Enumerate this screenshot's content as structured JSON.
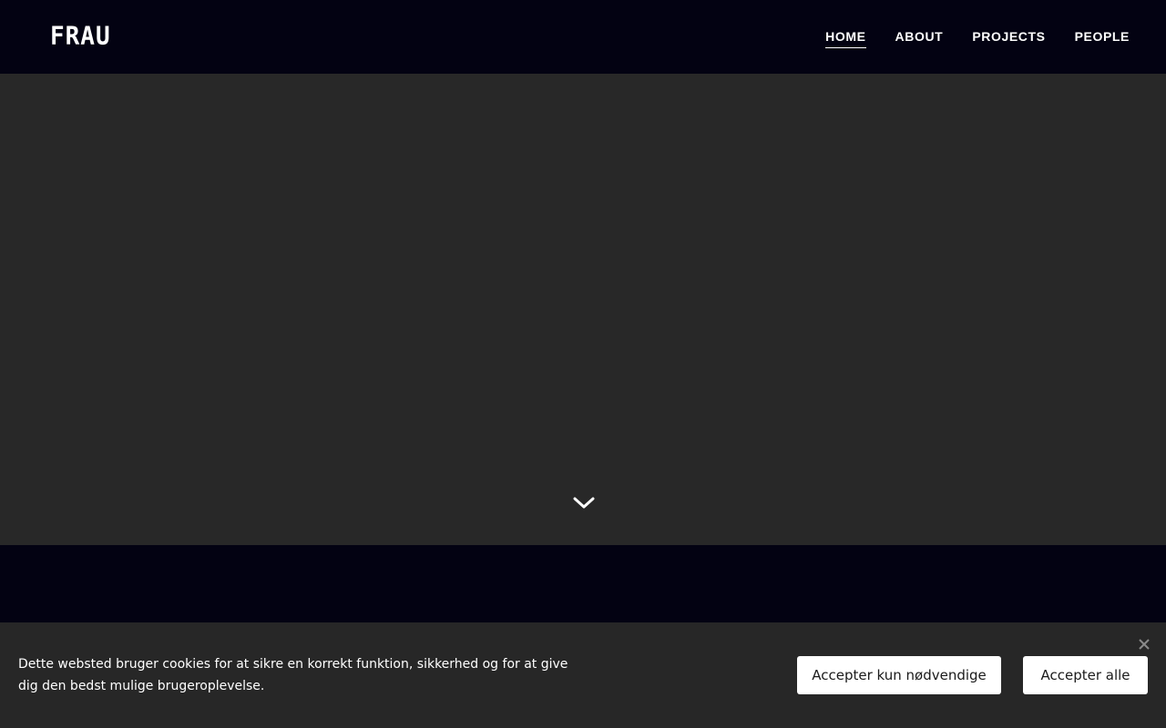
{
  "header": {
    "logo": "FRAU",
    "nav": [
      {
        "label": "HOME",
        "active": true
      },
      {
        "label": "ABOUT",
        "active": false
      },
      {
        "label": "PROJECTS",
        "active": false
      },
      {
        "label": "PEOPLE",
        "active": false
      }
    ]
  },
  "hero": {
    "scroll_icon": "chevron-down-icon"
  },
  "cookie_banner": {
    "text": "Dette websted bruger cookies for at sikre en korrekt funktion, sikkerhed og for at give dig den bedst mulige brugeroplevelse.",
    "accept_necessary_label": "Accepter kun nødvendige",
    "accept_all_label": "Accepter alle",
    "close_icon": "close-icon"
  },
  "colors": {
    "header_bg": "#030212",
    "hero_bg": "#282828",
    "banner_bg": "#272727",
    "text": "#ffffff"
  }
}
